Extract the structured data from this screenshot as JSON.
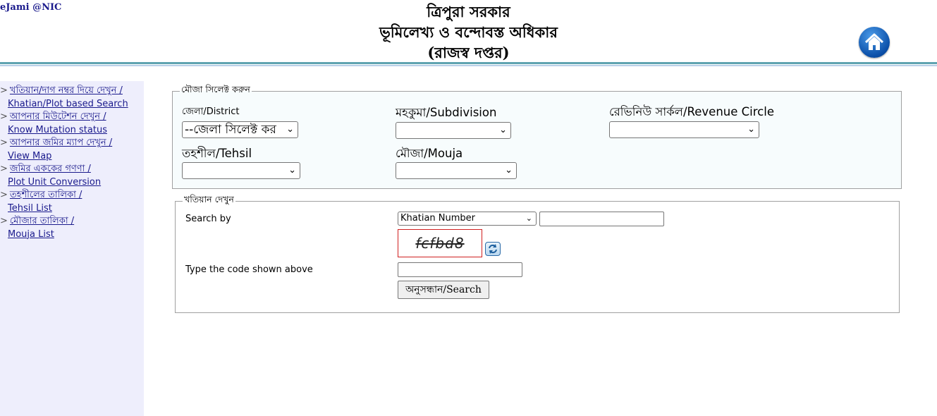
{
  "header": {
    "brand": "eJami @NIC",
    "title_line1": "ত্রিপুরা সরকার",
    "title_line2": "ভূমিলেখ্য ও বন্দোবস্ত অধিকার",
    "title_line3": "(রাজস্ব দপ্তর)",
    "home_icon": "home-icon"
  },
  "sidebar": {
    "items": [
      {
        "bn": "খতিয়ান/দাগ নম্বর দিয়ে দেখুন /",
        "en": "Khatian/Plot based Search"
      },
      {
        "bn": "আপনার মিউটেশন দেখুন /",
        "en": "Know Mutation status"
      },
      {
        "bn": "আপনার জমির ম্যাপ দেখুন /",
        "en": "View Map"
      },
      {
        "bn": "জমির এককের গণণা /",
        "en": "Plot Unit Conversion"
      },
      {
        "bn": "তহশীলের তালিকা /",
        "en": "Tehsil List"
      },
      {
        "bn": "মৌজার তালিকা /",
        "en": "Mouja List"
      }
    ]
  },
  "mouja_select": {
    "legend": "মৌজা সিলেক্ট করুন",
    "district_label": "জেলা/District",
    "district_value": "--জেলা সিলেক্ট কর",
    "subdivision_label": "মহকুমা/Subdivision",
    "subdivision_value": "",
    "revenue_circle_label": "রেভিনিউ সার্কল/Revenue Circle",
    "revenue_circle_value": "",
    "tehsil_label": "তহশীল/Tehsil",
    "tehsil_value": "",
    "mouja_label": "মৌজা/Mouja",
    "mouja_value": ""
  },
  "khatian": {
    "legend": "খতিয়ান দেখুন",
    "search_by_label": "Search by",
    "search_by_value": "Khatian Number",
    "search_value": "",
    "captcha_text": "fcfbd8",
    "code_label": "Type the code shown above",
    "code_value": "",
    "search_button": "অনুসন্ধান/Search"
  }
}
